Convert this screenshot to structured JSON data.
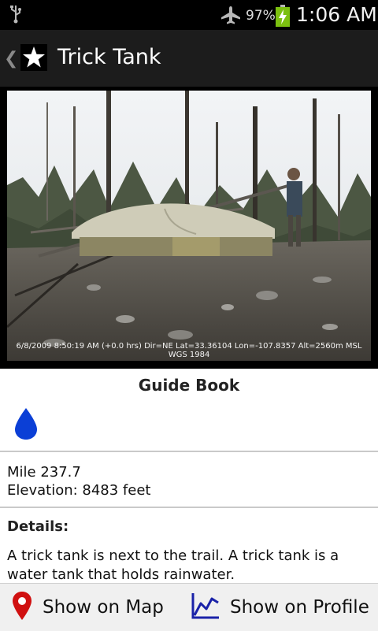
{
  "status_bar": {
    "battery_percent": "97%",
    "time": "1:06 AM",
    "icons": [
      "usb-icon",
      "airplane-mode-icon",
      "battery-charging-icon"
    ]
  },
  "action_bar": {
    "title": "Trick Tank",
    "icons": [
      "back-chevron-icon",
      "star-icon"
    ]
  },
  "photo": {
    "caption": "6/8/2009 8:50:19 AM (+0.0 hrs) Dir=NE Lat=33.36104 Lon=-107.8357 Alt=2560m MSL WGS 1984"
  },
  "guide": {
    "heading": "Guide Book",
    "icon": "water-drop-icon",
    "icon_color": "#0b3fd6"
  },
  "location": {
    "mile": "Mile 237.7",
    "elevation": "Elevation: 8483 feet"
  },
  "details": {
    "heading": "Details:",
    "text": "A trick tank is next to the trail. A trick tank is a water tank that holds rainwater."
  },
  "actions": {
    "map_label": "Show on Map",
    "profile_label": "Show on Profile",
    "map_icon_color": "#d01010",
    "profile_icon_color": "#1a22a8"
  }
}
